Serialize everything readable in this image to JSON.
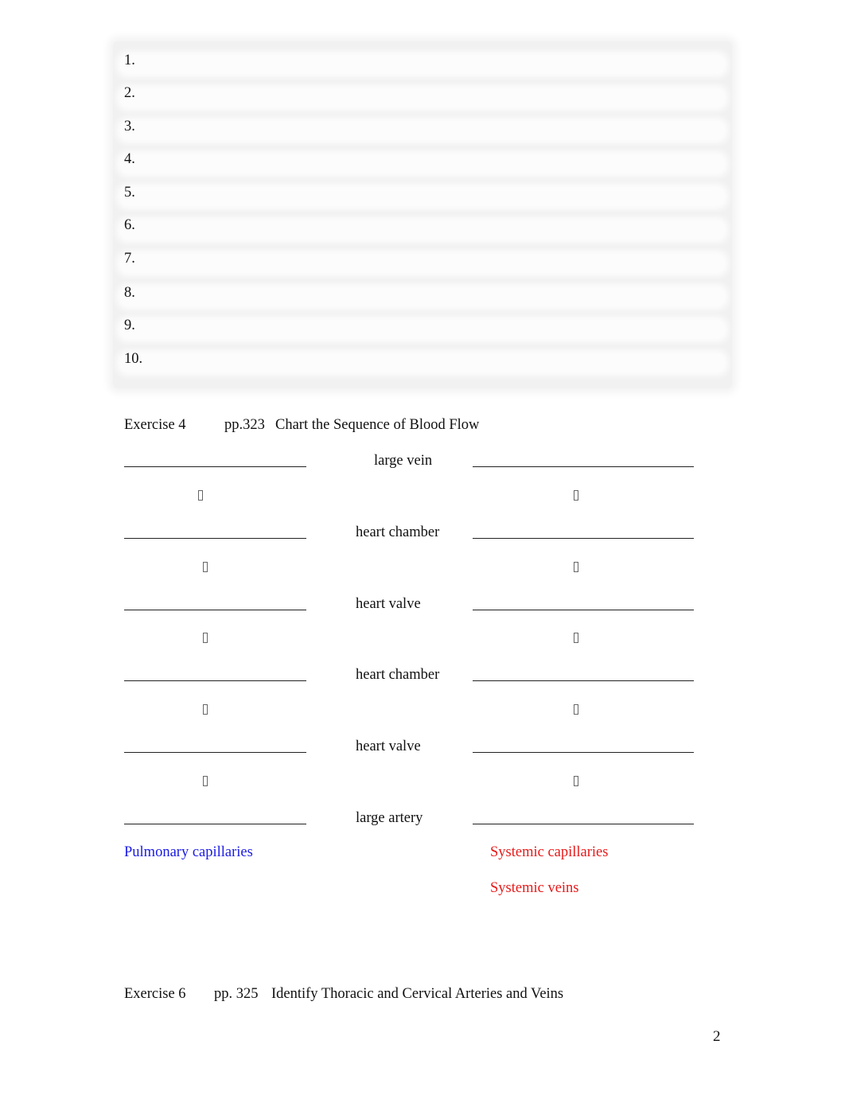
{
  "answer_list": {
    "items": [
      "1.",
      "2.",
      "3.",
      "4.",
      "5.",
      "6.",
      "7.",
      "8.",
      "9.",
      "10."
    ]
  },
  "exercise4": {
    "label": "Exercise 4",
    "pages": "pp.323",
    "title": "Chart the Sequence of Blood Flow",
    "rows": [
      {
        "center_label": "large vein"
      },
      {
        "center_label": "heart chamber"
      },
      {
        "center_label": "heart valve"
      },
      {
        "center_label": "heart chamber"
      },
      {
        "center_label": "heart valve"
      },
      {
        "center_label": "large artery"
      }
    ],
    "arrow_glyph": "down-arrow-icon (missing glyph box)",
    "left_footer": {
      "text": "Pulmonary capillaries",
      "color": "#1a1ae6"
    },
    "right_footer": [
      {
        "text": "Systemic capillaries",
        "color": "#e81919"
      },
      {
        "text": "Systemic veins",
        "color": "#e81919"
      }
    ]
  },
  "exercise6": {
    "label": "Exercise 6",
    "pages": "pp. 325",
    "title": "Identify Thoracic and Cervical Arteries and Veins"
  },
  "page_number": "2"
}
